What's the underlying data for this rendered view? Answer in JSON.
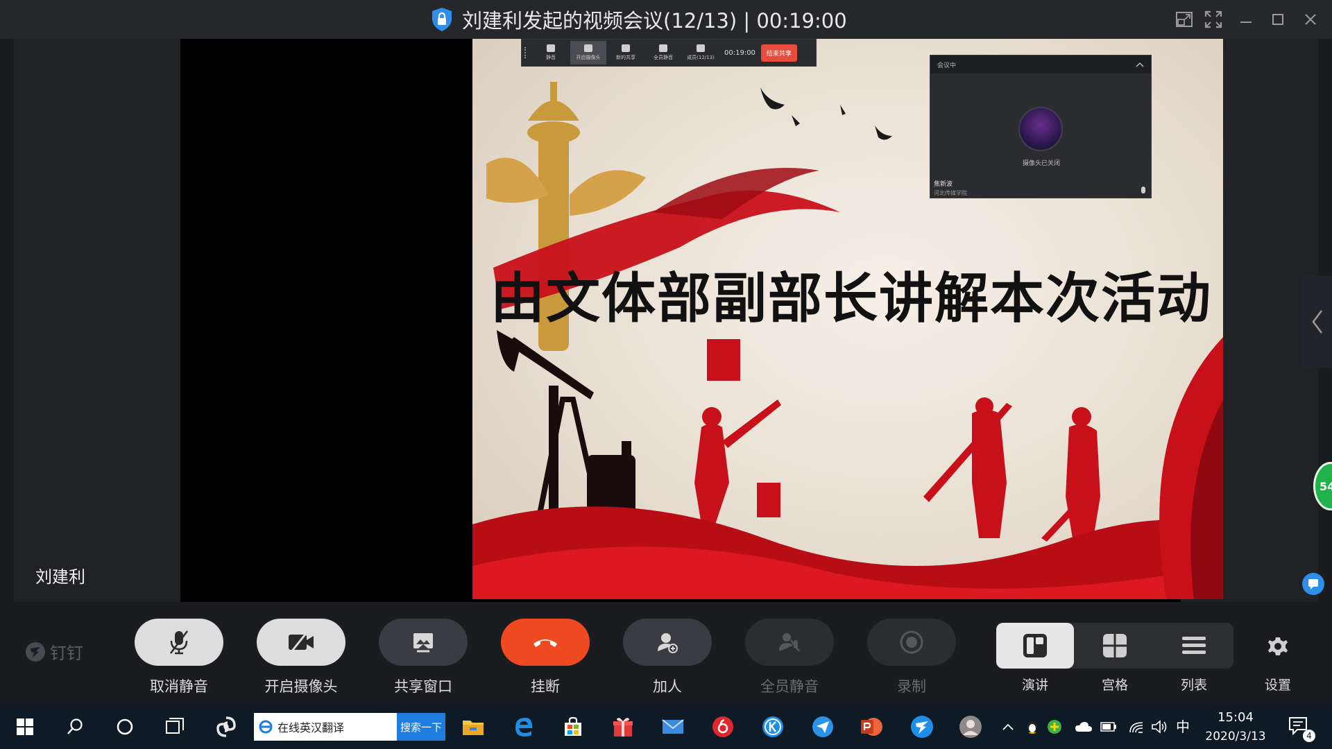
{
  "window": {
    "title": "刘建利发起的视频会议(12/13) | 00:19:00"
  },
  "stage": {
    "presenter_name": "刘建利",
    "slide_title": "由文体部副部长讲解本次活动",
    "floating_badge": "54"
  },
  "share_toolbar": {
    "items": [
      {
        "label": "静音"
      },
      {
        "label": "开启摄像头"
      },
      {
        "label": "新的共享"
      },
      {
        "label": "全员静音"
      },
      {
        "label": "成员(12/13)"
      }
    ],
    "timer": "00:19:00",
    "end_label": "结束共享"
  },
  "video_panel": {
    "status": "会议中",
    "camera_off": "摄像头已关闭",
    "participant_name": "焦新波",
    "participant_org": "河北传媒学院"
  },
  "controls": {
    "brand": "钉钉",
    "unmute": "取消静音",
    "camera": "开启摄像头",
    "share": "共享窗口",
    "hangup": "挂断",
    "add_person": "加人",
    "mute_all": "全员静音",
    "record": "录制",
    "layout_speaker": "演讲",
    "layout_grid": "宫格",
    "layout_list": "列表",
    "settings": "设置"
  },
  "taskbar": {
    "search_text": "在线英汉翻译",
    "search_button": "搜索一下",
    "ime": "中",
    "time": "15:04",
    "date": "2020/3/13",
    "notification_count": "4"
  },
  "colors": {
    "hangup": "#f04a23",
    "accent_blue": "#1f7de0",
    "slide_red": "#c8101a"
  }
}
